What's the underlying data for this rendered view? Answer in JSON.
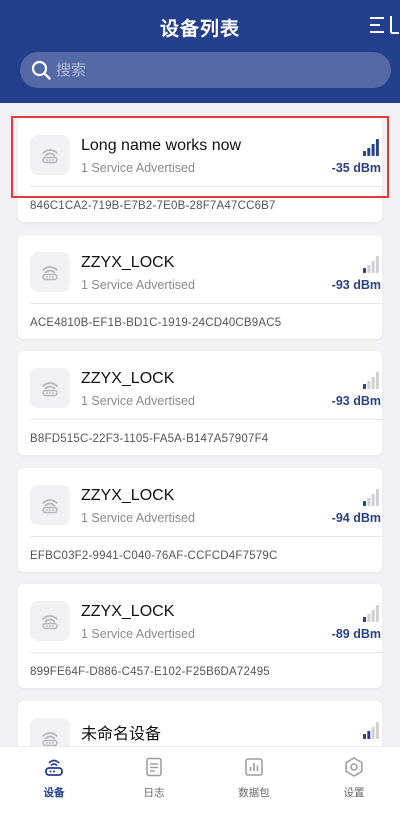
{
  "header": {
    "title": "设备列表",
    "search_placeholder": "搜索"
  },
  "devices": [
    {
      "name": "Long name works now",
      "services": "1 Service Advertised",
      "rssi": "-35 dBm",
      "uuid": "846C1CA2-719B-E7B2-7E0B-28F7A47CC6B7",
      "signal_level": 4
    },
    {
      "name": "ZZYX_LOCK",
      "services": "1 Service Advertised",
      "rssi": "-93 dBm",
      "uuid": "ACE4810B-EF1B-BD1C-1919-24CD40CB9AC5",
      "signal_level": 1
    },
    {
      "name": "ZZYX_LOCK",
      "services": "1 Service Advertised",
      "rssi": "-93 dBm",
      "uuid": "B8FD515C-22F3-1105-FA5A-B147A57907F4",
      "signal_level": 1
    },
    {
      "name": "ZZYX_LOCK",
      "services": "1 Service Advertised",
      "rssi": "-94 dBm",
      "uuid": "EFBC03F2-9941-C040-76AF-CCFCD4F7579C",
      "signal_level": 1
    },
    {
      "name": "ZZYX_LOCK",
      "services": "1 Service Advertised",
      "rssi": "-89 dBm",
      "uuid": "899FE64F-D886-C457-E102-F25B6DA72495",
      "signal_level": 1
    },
    {
      "name": "未命名设备",
      "services": "",
      "rssi": "",
      "uuid": "",
      "signal_level": 2
    }
  ],
  "tabs": [
    {
      "label": "设备",
      "icon": "router-icon",
      "active": true
    },
    {
      "label": "日志",
      "icon": "document-icon",
      "active": false
    },
    {
      "label": "数据包",
      "icon": "chart-icon",
      "active": false
    },
    {
      "label": "设置",
      "icon": "hexagon-settings-icon",
      "active": false
    }
  ],
  "colors": {
    "header_bg": "#243f8c",
    "accent": "#2a4286",
    "highlight": "#e53a3a"
  }
}
